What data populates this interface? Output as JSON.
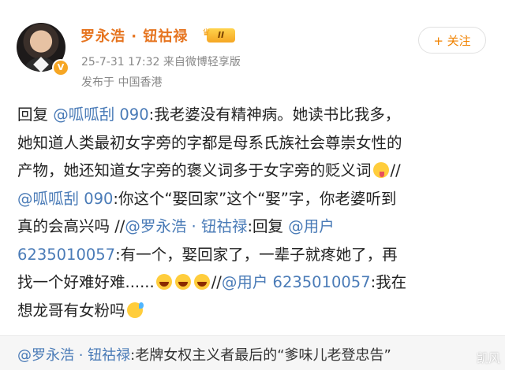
{
  "user": {
    "name": "罗永浩 · 钮祜禄",
    "level_badge": "II",
    "verified_mark": "V",
    "timestamp_source": "25-7-31 17:32  来自微博轻享版",
    "location": "发布于  中国香港",
    "follow_label": "+ 关注"
  },
  "post": {
    "lines": [
      [
        {
          "t": "回复 "
        },
        {
          "t": "@呱呱刮 090",
          "link": true
        },
        {
          "t": ":我老婆没有精神病。她读书比我多，"
        }
      ],
      [
        {
          "t": "她知道人类最初女字旁的字都是母系氏族社会尊崇女性的"
        }
      ],
      [
        {
          "t": "产物，她还知道女字旁的褒义词多于女字旁的贬义词"
        },
        {
          "emoji": "tongue"
        },
        {
          "t": "//"
        }
      ],
      [
        {
          "t": "@呱呱刮 090",
          "link": true
        },
        {
          "t": ":你这个“娶回家”这个“娶”字，你老婆听到"
        }
      ],
      [
        {
          "t": "真的会高兴吗 //"
        },
        {
          "t": "@罗永浩 · 钮祜禄",
          "link": true
        },
        {
          "t": ":回复 "
        },
        {
          "t": "@用户",
          "link": true
        }
      ],
      [
        {
          "t": "6235010057",
          "link": true
        },
        {
          "t": ":有一个，娶回家了，一辈子就疼她了，再"
        }
      ],
      [
        {
          "t": "找一个好难好难......"
        },
        {
          "emoji": "laugh"
        },
        {
          "emoji": "laugh"
        },
        {
          "emoji": "laugh"
        },
        {
          "t": "//"
        },
        {
          "t": "@用户 6235010057",
          "link": true
        },
        {
          "t": ":我在"
        }
      ],
      [
        {
          "t": "想龙哥有女粉吗"
        },
        {
          "emoji": "sweat"
        }
      ]
    ]
  },
  "footer": {
    "text_link": "@罗永浩 · 钮祜禄",
    "text_rest": ":老牌女权主义者最后的“爹味儿老登忠告”",
    "watermark": "凯风"
  },
  "colors": {
    "name": "#e6741f",
    "link": "#4a7bb7",
    "follow": "#f08200"
  }
}
